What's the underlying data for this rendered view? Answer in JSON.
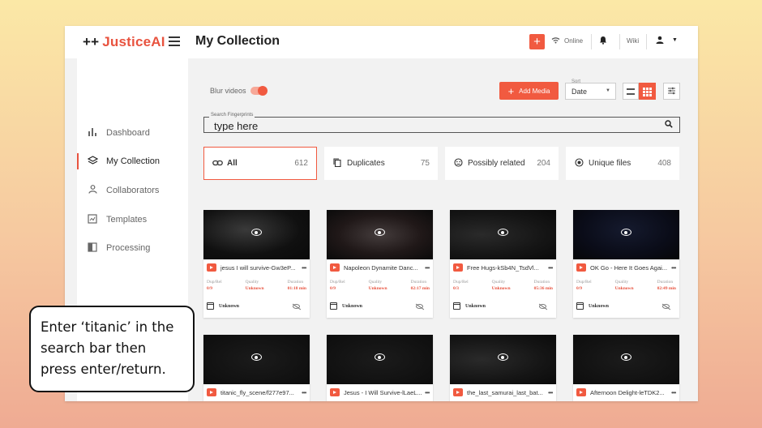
{
  "header": {
    "logo_plus": "++",
    "logo_text": "JusticeAI",
    "page_title": "My Collection",
    "add_icon": "+",
    "status": "Online",
    "wiki": "Wiki"
  },
  "sidebar": {
    "items": [
      {
        "label": "Dashboard",
        "icon": "bar-chart-icon",
        "glyph": "▐",
        "active": false
      },
      {
        "label": "My Collection",
        "icon": "layers-icon",
        "glyph": "◈",
        "active": true
      },
      {
        "label": "Collaborators",
        "icon": "person-icon",
        "glyph": "●",
        "active": false
      },
      {
        "label": "Templates",
        "icon": "template-icon",
        "glyph": "▣",
        "active": false
      },
      {
        "label": "Processing",
        "icon": "processing-icon",
        "glyph": "◧",
        "active": false
      }
    ]
  },
  "toolbar": {
    "blur_label": "Blur videos",
    "blur_on": true,
    "add_media": "Add Media",
    "sort_label": "Sort",
    "sort_value": "Date"
  },
  "search": {
    "label": "Search Fingerprints",
    "placeholder": "type here"
  },
  "filters": [
    {
      "label": "All",
      "count": "612",
      "icon": "link-icon",
      "glyph": "∞",
      "active": true
    },
    {
      "label": "Duplicates",
      "count": "75",
      "icon": "copy-icon",
      "glyph": "❐",
      "active": false
    },
    {
      "label": "Possibly related",
      "count": "204",
      "icon": "related-icon",
      "glyph": "☺",
      "active": false
    },
    {
      "label": "Unique files",
      "count": "408",
      "icon": "unique-icon",
      "glyph": "◉",
      "active": false
    }
  ],
  "stat_labels": {
    "duprel": "Dup/Rel",
    "quality": "Quality",
    "duration": "Duration"
  },
  "videos": [
    {
      "title": "jesus I will survive-Gw3eP...",
      "duprel": "0/9",
      "quality": "Unknown",
      "duration": "01:18 min",
      "date": "Unknown"
    },
    {
      "title": "Napoleon Dynamite Danc...",
      "duprel": "0/9",
      "quality": "Unknown",
      "duration": "02:17 min",
      "date": "Unknown"
    },
    {
      "title": "Free Hugs-kSb4N_TsdVl...",
      "duprel": "0/3",
      "quality": "Unknown",
      "duration": "05:36 min",
      "date": "Unknown"
    },
    {
      "title": "OK Go - Here It Goes Agai...",
      "duprel": "0/9",
      "quality": "Unknown",
      "duration": "02:49 min",
      "date": "Unknown"
    },
    {
      "title": "titanic_fly_scene/f277e97...",
      "duprel": "",
      "quality": "",
      "duration": "",
      "date": ""
    },
    {
      "title": "Jesus - I Will Survive-lLaeL...",
      "duprel": "",
      "quality": "",
      "duration": "",
      "date": ""
    },
    {
      "title": "the_last_samurai_last_bat...",
      "duprel": "",
      "quality": "",
      "duration": "",
      "date": ""
    },
    {
      "title": "Afternoon Delight-leTDK2...",
      "duprel": "",
      "quality": "",
      "duration": "",
      "date": ""
    }
  ],
  "instruction": "Enter ‘titanic’ in the search bar then press enter/return.",
  "colors": {
    "accent": "#f15a40",
    "background": "#f2f2f2"
  }
}
